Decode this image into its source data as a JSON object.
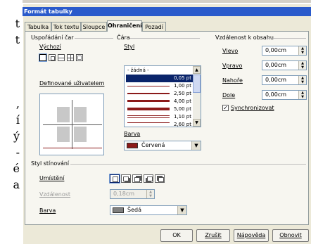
{
  "document": {
    "chars": [
      "t",
      "t",
      ",",
      "í",
      "ý",
      "-",
      "é",
      "a"
    ]
  },
  "dialog": {
    "title": "Formát tabulky"
  },
  "tabs": [
    {
      "label": "Tabulka"
    },
    {
      "label": "Tok textu"
    },
    {
      "label": "Sloupce"
    },
    {
      "label": "Ohraničení",
      "active": true
    },
    {
      "label": "Pozadí"
    }
  ],
  "line_arrangement": {
    "title": "Uspořádání čar",
    "default_label": "Výchozí",
    "user_defined_label": "Definované uživatelem"
  },
  "line": {
    "title": "Čára",
    "style_label": "Styl",
    "styles": [
      {
        "label": "- žádná -"
      },
      {
        "label": "0,05 pt",
        "selected": true
      },
      {
        "label": "1,00 pt"
      },
      {
        "label": "2,50 pt"
      },
      {
        "label": "4,00 pt"
      },
      {
        "label": "5,00 pt"
      },
      {
        "label": "1,10 pt"
      },
      {
        "label": "2,60 pt"
      }
    ],
    "color_label": "Barva",
    "color_value": "Červená",
    "color_hex": "#8b1a1a"
  },
  "spacing": {
    "title": "Vzdálenost k obsahu",
    "left_label": "Vlevo",
    "left_value": "0,00cm",
    "right_label": "Vpravo",
    "right_value": "0,00cm",
    "top_label": "Nahoře",
    "top_value": "0,00cm",
    "bottom_label": "Dole",
    "bottom_value": "0,00cm",
    "sync_label": "Synchronizovat",
    "sync_checked": true
  },
  "shadow": {
    "title": "Styl stínování",
    "position_label": "Umístění",
    "distance_label": "Vzdálenost",
    "distance_value": "0,18cm",
    "color_label": "Barva",
    "color_value": "Šedá",
    "color_hex": "#808080"
  },
  "buttons": {
    "ok": "OK",
    "cancel": "Zrušit",
    "help": "Nápověda",
    "reset": "Obnovit"
  }
}
